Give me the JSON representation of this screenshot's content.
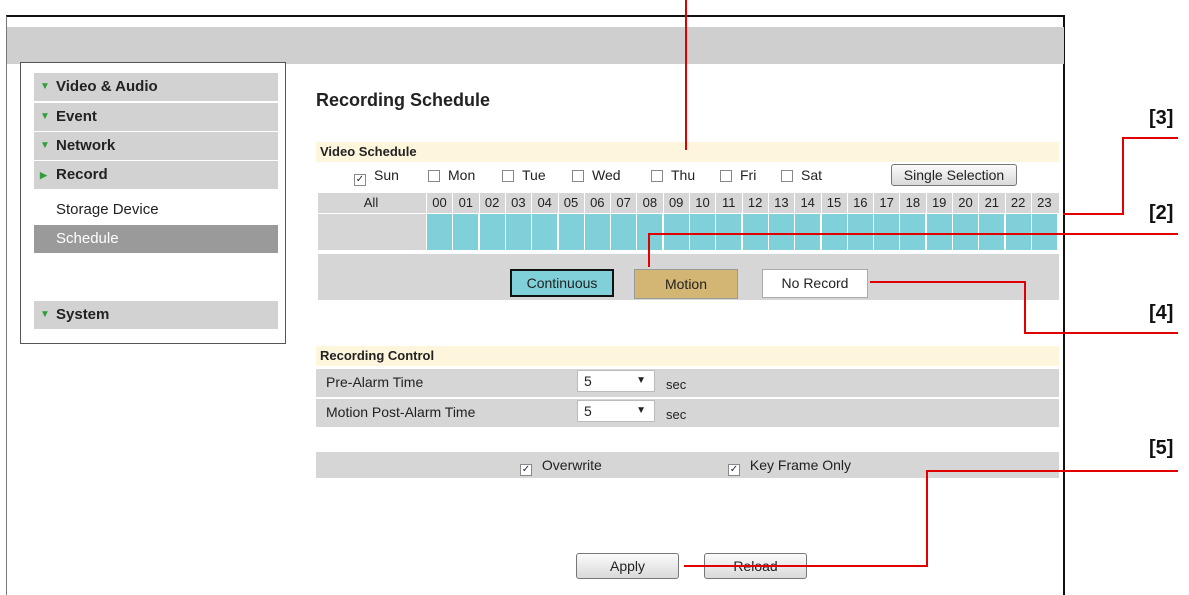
{
  "sidebar": {
    "items": [
      {
        "label": "Video & Audio",
        "icon": "chevron-down-icon"
      },
      {
        "label": "Event",
        "icon": "chevron-down-icon"
      },
      {
        "label": "Network",
        "icon": "chevron-down-icon"
      },
      {
        "label": "Record",
        "icon": "chevron-right-icon"
      }
    ],
    "sub_items": [
      {
        "label": "Storage Device",
        "selected": false
      },
      {
        "label": "Schedule",
        "selected": true
      }
    ],
    "system": {
      "label": "System",
      "icon": "chevron-down-icon"
    }
  },
  "page_title": "Recording Schedule",
  "video_schedule": {
    "header": "Video Schedule",
    "days": [
      {
        "label": "Sun",
        "checked": true
      },
      {
        "label": "Mon",
        "checked": false
      },
      {
        "label": "Tue",
        "checked": false
      },
      {
        "label": "Wed",
        "checked": false
      },
      {
        "label": "Thu",
        "checked": false
      },
      {
        "label": "Fri",
        "checked": false
      },
      {
        "label": "Sat",
        "checked": false
      }
    ],
    "single_selection_label": "Single Selection",
    "all_label": "All",
    "hours": [
      "00",
      "01",
      "02",
      "03",
      "04",
      "05",
      "06",
      "07",
      "08",
      "09",
      "10",
      "11",
      "12",
      "13",
      "14",
      "15",
      "16",
      "17",
      "18",
      "19",
      "20",
      "21",
      "22",
      "23"
    ],
    "modes": {
      "continuous": "Continuous",
      "motion": "Motion",
      "no_record": "No Record"
    },
    "colors": {
      "continuous": "#7fd0d8",
      "motion": "#d3b673",
      "no_record": "#ffffff"
    }
  },
  "recording_control": {
    "header": "Recording Control",
    "rows": [
      {
        "label": "Pre-Alarm Time",
        "value": "5",
        "unit": "sec"
      },
      {
        "label": "Motion Post-Alarm Time",
        "value": "5",
        "unit": "sec"
      }
    ]
  },
  "options": {
    "overwrite": {
      "label": "Overwrite",
      "checked": true
    },
    "key_frame_only": {
      "label": "Key Frame Only",
      "checked": true
    }
  },
  "buttons": {
    "apply": "Apply",
    "reload": "Reload"
  },
  "annotations": {
    "a3": "[3]",
    "a2": "[2]",
    "a4": "[4]",
    "a5": "[5]"
  },
  "check_mark": "✓"
}
